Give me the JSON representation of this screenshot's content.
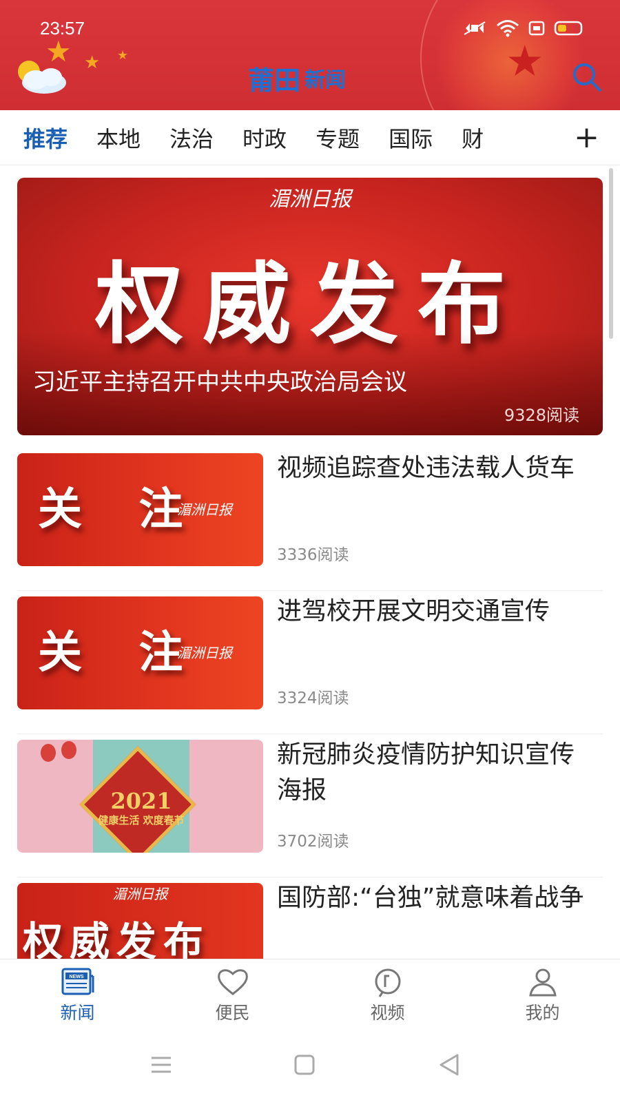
{
  "status_bar": {
    "time": "23:57"
  },
  "header": {
    "logo_text": "新闻",
    "logo_mark": "莆田"
  },
  "tabs": [
    {
      "label": "推荐",
      "active": true
    },
    {
      "label": "本地"
    },
    {
      "label": "法治"
    },
    {
      "label": "时政"
    },
    {
      "label": "专题"
    },
    {
      "label": "国际"
    },
    {
      "label": "财"
    }
  ],
  "tab_add_label": "+",
  "banner": {
    "brand": "湄洲日报",
    "headline_image_text": "权威发布",
    "caption": "习近平主持召开中共中央政治局会议",
    "reads": "9328阅读"
  },
  "news": [
    {
      "title": "视频追踪查处违法载人货车",
      "reads": "3336阅读",
      "thumb_text": "关 注",
      "thumb_brand": "湄洲日报"
    },
    {
      "title": "进驾校开展文明交通宣传",
      "reads": "3324阅读",
      "thumb_text": "关 注",
      "thumb_brand": "湄洲日报"
    },
    {
      "title": "新冠肺炎疫情防护知识宣传海报",
      "reads": "3702阅读",
      "thumb_year": "2021",
      "thumb_sub": "健康生活 欢度春节"
    },
    {
      "title": "国防部:“台独”就意味着战争",
      "reads": "",
      "thumb_text": "权威发布",
      "thumb_brand": "湄洲日报"
    }
  ],
  "bottom_nav": [
    {
      "label": "新闻",
      "icon": "news-icon",
      "active": true
    },
    {
      "label": "便民",
      "icon": "heart-icon"
    },
    {
      "label": "视频",
      "icon": "video-icon"
    },
    {
      "label": "我的",
      "icon": "profile-icon"
    }
  ],
  "colors": {
    "header_red": "#d9363b",
    "accent_blue": "#1a5fb4",
    "banner_red": "#e8372c"
  }
}
